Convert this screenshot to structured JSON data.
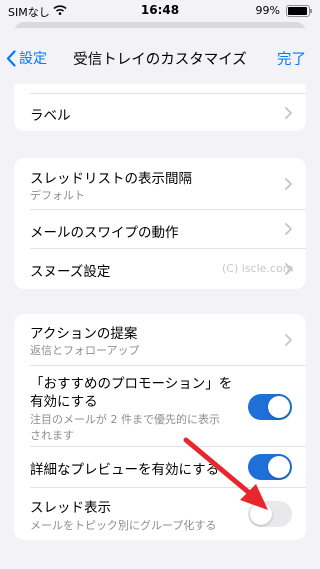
{
  "status_bar": {
    "carrier": "SIMなし",
    "time": "16:48",
    "battery": "99%"
  },
  "nav": {
    "back_label": "設定",
    "title": "受信トレイのカスタマイズ",
    "done_label": "完了"
  },
  "group1": {
    "label_row": {
      "title": "ラベル"
    }
  },
  "group2": {
    "density": {
      "title": "スレッドリストの表示間隔",
      "subtitle": "デフォルト"
    },
    "swipe": {
      "title": "メールのスワイプの動作"
    },
    "snooze": {
      "title": "スヌーズ設定"
    }
  },
  "watermark": "(C) iscle.com",
  "group3": {
    "actions": {
      "title": "アクションの提案",
      "subtitle": "返信とフォローアップ"
    },
    "promotions": {
      "title_line1": "「おすすめのプロモーション」を",
      "title_line2": "有効にする",
      "subtitle_line1": "注目のメールが 2 件まで優先的に表示",
      "subtitle_line2": "されます",
      "enabled": true
    },
    "preview": {
      "title": "詳細なプレビューを有効にする",
      "enabled": true
    },
    "threads": {
      "title": "スレッド表示",
      "subtitle": "メールをトピック別にグループ化する",
      "enabled": false
    }
  },
  "colors": {
    "accent": "#007aff",
    "toggle_on": "#1f6fd8",
    "annotation_arrow": "#e8262d"
  }
}
